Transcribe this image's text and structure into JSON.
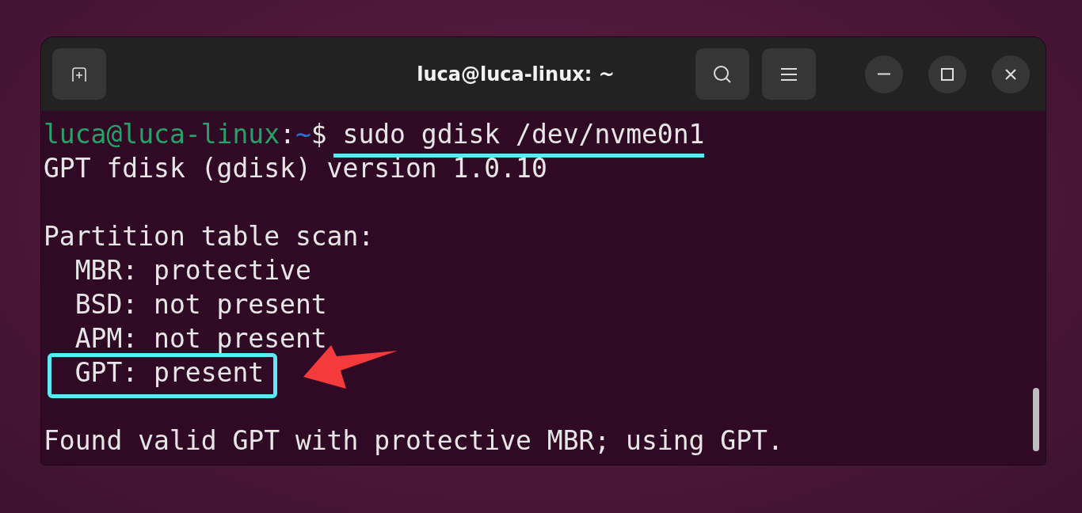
{
  "window": {
    "title": "luca@luca-linux: ~"
  },
  "terminal": {
    "lines": [
      {
        "kind": "prompt",
        "user": "luca@luca-linux",
        "separator": ":",
        "path": "~",
        "symbol": "$",
        "command": "sudo gdisk /dev/nvme0n1",
        "underlined": true,
        "boxed": false,
        "pointer": false
      },
      {
        "kind": "output",
        "text": "GPT fdisk (gdisk) version 1.0.10",
        "underlined": false,
        "boxed": false,
        "pointer": false
      },
      {
        "kind": "blank"
      },
      {
        "kind": "output",
        "text": "Partition table scan:",
        "underlined": false,
        "boxed": false,
        "pointer": false
      },
      {
        "kind": "output",
        "text": "  MBR: protective",
        "underlined": false,
        "boxed": false,
        "pointer": false
      },
      {
        "kind": "output",
        "text": "  BSD: not present",
        "underlined": false,
        "boxed": false,
        "pointer": false
      },
      {
        "kind": "output",
        "text": "  APM: not present",
        "underlined": false,
        "boxed": false,
        "pointer": false
      },
      {
        "kind": "output",
        "text": "  GPT: present",
        "underlined": false,
        "boxed": true,
        "pointer": true
      },
      {
        "kind": "blank"
      },
      {
        "kind": "output",
        "text": "Found valid GPT with protective MBR; using GPT.",
        "underlined": false,
        "boxed": false,
        "pointer": false
      }
    ]
  }
}
